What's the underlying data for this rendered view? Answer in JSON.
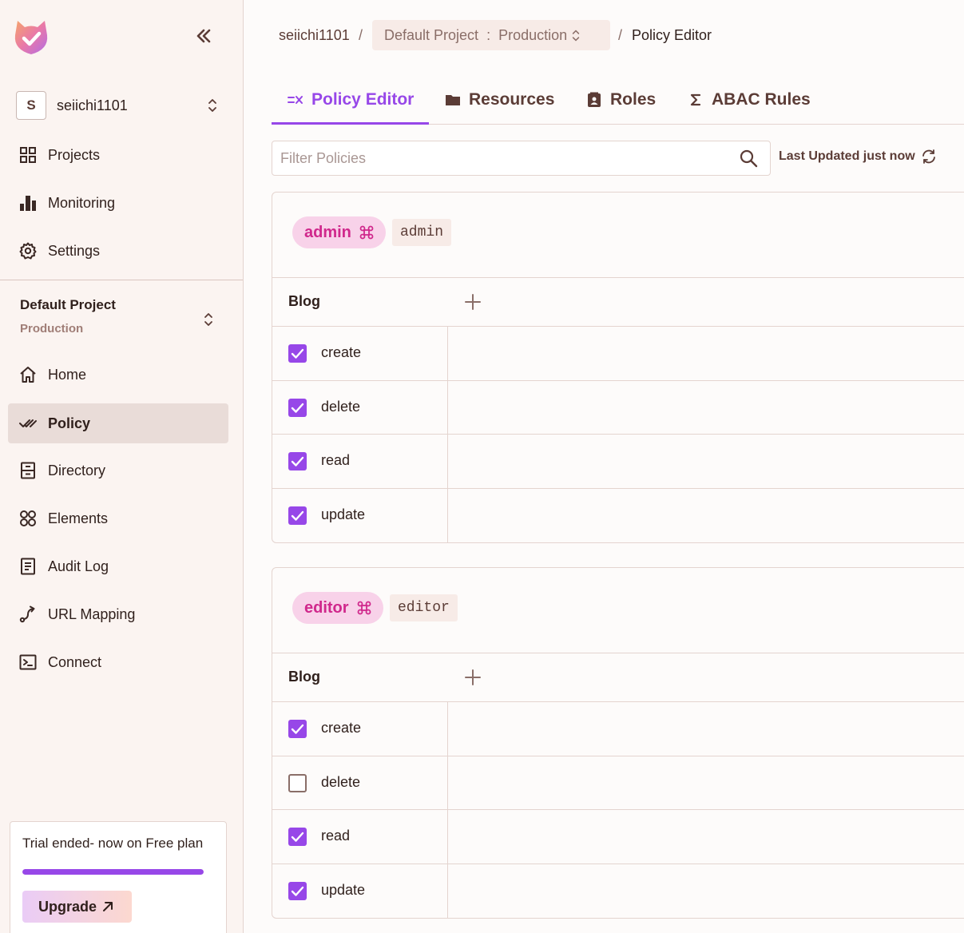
{
  "sidebar": {
    "org": {
      "initial": "S",
      "name": "seiichi1101"
    },
    "top_nav": [
      {
        "label": "Projects",
        "icon": "grid-icon"
      },
      {
        "label": "Monitoring",
        "icon": "bar-chart-icon"
      },
      {
        "label": "Settings",
        "icon": "gear-icon"
      }
    ],
    "project": {
      "name": "Default Project",
      "env": "Production"
    },
    "project_nav": [
      {
        "label": "Home",
        "icon": "home-icon"
      },
      {
        "label": "Policy",
        "icon": "double-check-icon",
        "active": true
      },
      {
        "label": "Directory",
        "icon": "directory-icon"
      },
      {
        "label": "Elements",
        "icon": "elements-icon"
      },
      {
        "label": "Audit Log",
        "icon": "document-icon"
      },
      {
        "label": "URL Mapping",
        "icon": "route-icon"
      },
      {
        "label": "Connect",
        "icon": "terminal-icon"
      }
    ],
    "trial": {
      "text": "Trial ended- now on Free plan",
      "progress": 1.0,
      "upgrade_label": "Upgrade"
    }
  },
  "breadcrumb": {
    "org": "seiichi1101",
    "sep": "/",
    "project": "Default Project",
    "colon": ":",
    "env": "Production",
    "current": "Policy Editor"
  },
  "tabs": [
    {
      "label": "Policy Editor",
      "icon": "policy-editor-icon",
      "active": true
    },
    {
      "label": "Resources",
      "icon": "folder-icon"
    },
    {
      "label": "Roles",
      "icon": "badge-icon"
    },
    {
      "label": "ABAC Rules",
      "icon": "sigma-icon"
    }
  ],
  "filter": {
    "placeholder": "Filter Policies",
    "value": ""
  },
  "last_updated": "Last Updated just now",
  "roles": [
    {
      "name": "admin",
      "key": "admin",
      "resource": "Blog",
      "actions": [
        {
          "label": "create",
          "checked": true
        },
        {
          "label": "delete",
          "checked": true
        },
        {
          "label": "read",
          "checked": true
        },
        {
          "label": "update",
          "checked": true
        }
      ]
    },
    {
      "name": "editor",
      "key": "editor",
      "resource": "Blog",
      "actions": [
        {
          "label": "create",
          "checked": true
        },
        {
          "label": "delete",
          "checked": false
        },
        {
          "label": "read",
          "checked": true
        },
        {
          "label": "update",
          "checked": true
        }
      ]
    }
  ],
  "colors": {
    "accent": "#9747e8",
    "role_pill_bg": "#f8d2e9",
    "role_pill_text": "#d0288c",
    "sidebar_bg": "#fbf4f1"
  }
}
